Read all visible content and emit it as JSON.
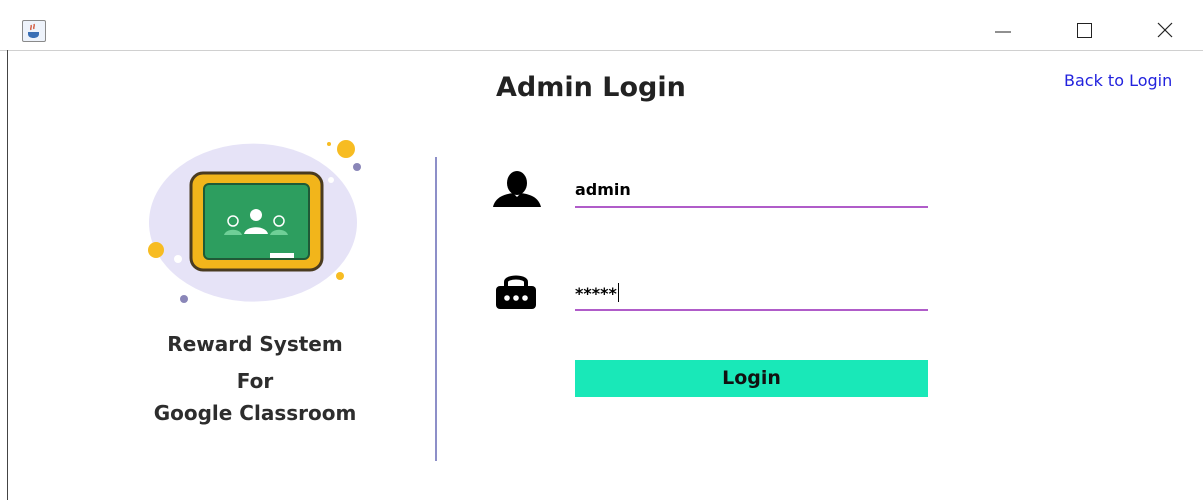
{
  "window": {
    "app_icon": "java-icon",
    "controls": [
      "minimize-icon",
      "maximize-icon",
      "close-icon"
    ]
  },
  "header": {
    "title": "Admin Login",
    "back_link": "Back to Login"
  },
  "branding": {
    "illustration": "google-classroom-illustration",
    "line1": "Reward System",
    "line2": "For",
    "line3": "Google Classroom"
  },
  "form": {
    "username_icon": "user-icon",
    "username_value": "admin",
    "password_icon": "lock-icon",
    "password_value": "*****",
    "login_label": "Login"
  },
  "colors": {
    "accent_button": "#19e8b8",
    "field_underline": "#b05cc9",
    "divider": "#8d8fc8",
    "link": "#2222dd"
  }
}
